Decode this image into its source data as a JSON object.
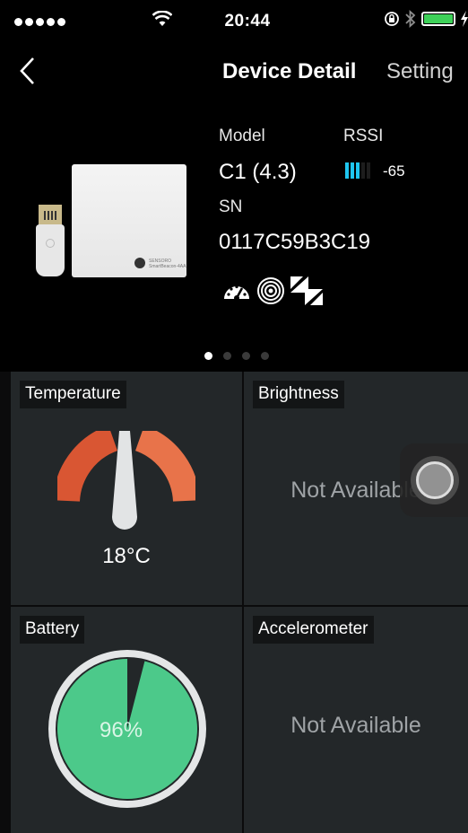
{
  "status_bar": {
    "time": "20:44",
    "signal_bars": 5,
    "battery_level": 1.0
  },
  "nav": {
    "back_icon": "chevron-left-icon",
    "title": "Device Detail",
    "setting": "Setting"
  },
  "device": {
    "model_label": "Model",
    "model_value": "C1 (4.3)",
    "rssi_label": "RSSI",
    "rssi_value": "-65",
    "rssi_bars_filled": 3,
    "rssi_bars_total": 5,
    "sn_label": "SN",
    "sn_value": "0117C59B3C19",
    "feature_icons": [
      "speedometer-icon",
      "broadcast-icon",
      "lightning-icon"
    ],
    "beacon_text": [
      "SENSORO",
      "SmartBeacon-4AA"
    ]
  },
  "pager": {
    "pages": 4,
    "active": 1
  },
  "tiles": {
    "temperature": {
      "label": "Temperature",
      "value": "18°C"
    },
    "brightness": {
      "label": "Brightness",
      "value": "Not Available"
    },
    "battery": {
      "label": "Battery",
      "value": "96%",
      "level": 0.96
    },
    "accelerometer": {
      "label": "Accelerometer",
      "value": "Not Available"
    }
  },
  "colors": {
    "accent_cyan": "#1ec6f0",
    "gauge_orange": "#e35f36",
    "battery_green": "#4cc98a",
    "tile_bg": "#232729"
  }
}
